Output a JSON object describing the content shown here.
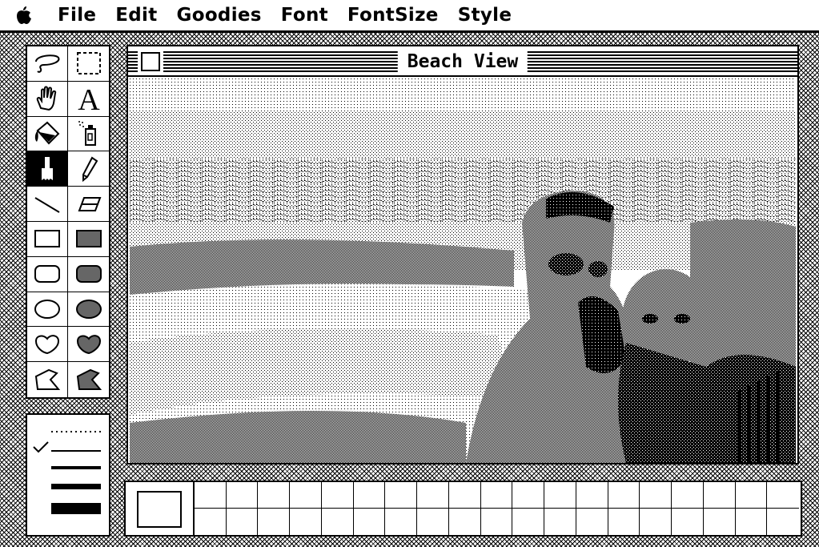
{
  "menubar": {
    "apple_icon": "apple-icon",
    "items": [
      "File",
      "Edit",
      "Goodies",
      "Font",
      "FontSize",
      "Style"
    ]
  },
  "window": {
    "title": "Beach View",
    "content": "dithered black-and-white photo of two people at a beach with surf"
  },
  "tools": [
    {
      "name": "lasso",
      "icon": "lasso-icon"
    },
    {
      "name": "selection-rectangle",
      "icon": "marquee-icon"
    },
    {
      "name": "grabber",
      "icon": "hand-icon"
    },
    {
      "name": "text",
      "icon": "text-icon"
    },
    {
      "name": "paint-bucket",
      "icon": "paint-bucket-icon"
    },
    {
      "name": "spray-can",
      "icon": "spray-can-icon"
    },
    {
      "name": "paintbrush",
      "icon": "paintbrush-icon",
      "selected": true
    },
    {
      "name": "pencil",
      "icon": "pencil-icon"
    },
    {
      "name": "line",
      "icon": "line-icon"
    },
    {
      "name": "eraser",
      "icon": "eraser-icon"
    },
    {
      "name": "rectangle",
      "icon": "rectangle-icon"
    },
    {
      "name": "filled-rectangle",
      "icon": "filled-rectangle-icon"
    },
    {
      "name": "rounded-rectangle",
      "icon": "rounded-rectangle-icon"
    },
    {
      "name": "filled-rounded-rectangle",
      "icon": "filled-rounded-rectangle-icon"
    },
    {
      "name": "oval",
      "icon": "oval-icon"
    },
    {
      "name": "filled-oval",
      "icon": "filled-oval-icon"
    },
    {
      "name": "freeform",
      "icon": "freeform-icon"
    },
    {
      "name": "filled-freeform",
      "icon": "filled-freeform-icon"
    },
    {
      "name": "polygon",
      "icon": "polygon-icon"
    },
    {
      "name": "filled-polygon",
      "icon": "filled-polygon-icon"
    }
  ],
  "line_widths": {
    "options": [
      "dotted",
      "1",
      "2",
      "4",
      "8"
    ],
    "selected": "1",
    "check_icon": "checkmark-icon"
  },
  "patterns": {
    "count": 38,
    "current": "white"
  }
}
